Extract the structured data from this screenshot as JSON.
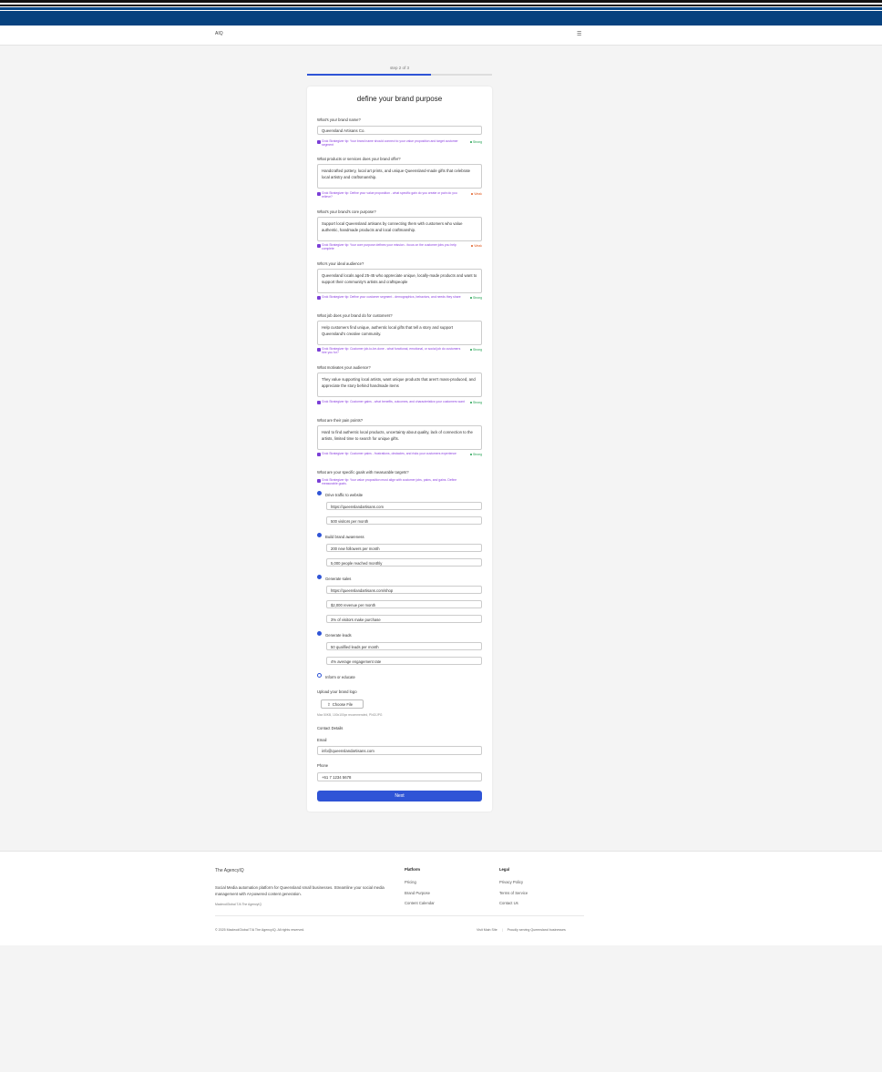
{
  "header": {
    "logo_alt": "AIQ",
    "menu_icon": "hamburger-icon"
  },
  "progress": {
    "label": "step 2 of 3",
    "value": 0.67
  },
  "form": {
    "title": "define your brand purpose",
    "tip_prefix": "Grok Strategizer tip:",
    "questions": [
      {
        "label": "What's your brand name?",
        "value": "Queensland Artisans Co.",
        "tip": "Grok Strategizer tip: Your brand name should connect to your value proposition and target customer segment",
        "strength": "Strong"
      },
      {
        "label": "What products or services does your brand offer?",
        "value": "Handcrafted pottery, local art prints, and unique Queensland-made gifts that celebrate local artistry and craftsmanship.",
        "tip": "Grok Strategizer tip: Define your value proposition - what specific gain do you create or pain do you relieve?",
        "strength": "Weak"
      },
      {
        "label": "What's your brand's core purpose?",
        "value": "Support local Queensland artisans by connecting them with customers who value authentic, handmade products and local craftmanship.",
        "tip": "Grok Strategizer tip: Your core purpose defines your mission - focus on the customer jobs you help complete",
        "strength": "Weak"
      },
      {
        "label": "Who's your ideal audience?",
        "value": "Queensland locals aged 25-45 who appreciate unique, locally-made products and want to support their community's artists and craftspeople",
        "tip": "Grok Strategizer tip: Define your customer segment - demographics, behaviors, and needs they share",
        "strength": "Strong"
      },
      {
        "label": "What job does your brand do for customers?",
        "value": "Help customers find unique, authentic local gifts that tell a story and support Queensland's creative community.",
        "tip": "Grok Strategizer tip: Customer job-to-be-done - what functional, emotional, or social job do customers hire you for?",
        "strength": "Strong"
      },
      {
        "label": "What motivates your audience?",
        "value": "They value supporting local artists, want unique products that aren't mass-produced, and appreciate the story behind handmade items",
        "tip": "Grok Strategizer tip: Customer gains - what benefits, outcomes, and characteristics your customers want",
        "strength": "Strong"
      },
      {
        "label": "What are their pain points?",
        "value": "Hard to find authentic local products, uncertainty about quality, lack of connection to the artists, limited time to search for unique gifts.",
        "tip": "Grok Strategizer tip: Customer pains - frustrations, obstacles, and risks your customers experience",
        "strength": "Strong"
      }
    ],
    "goals": {
      "label": "What are your specific goals with measurable targets?",
      "tip": "Grok Strategizer tip: Your value proposition must align with customer jobs, pains, and gains. Define measurable goals.",
      "items": [
        {
          "label": "Drive traffic to website",
          "checked": true,
          "fields": [
            "https://queenslandartisans.com",
            "500 visitors per month"
          ]
        },
        {
          "label": "Build brand awareness",
          "checked": true,
          "fields": [
            "200 new followers per month",
            "5,000 people reached monthly"
          ]
        },
        {
          "label": "Generate sales",
          "checked": true,
          "fields": [
            "https://queenslandartisans.com/shop",
            "$2,000 revenue per month",
            "3% of visitors make purchase"
          ]
        },
        {
          "label": "Generate leads",
          "checked": true,
          "fields": [
            "50 qualified leads per month",
            "4% average engagement rate"
          ]
        },
        {
          "label": "Inform or educate",
          "checked": false,
          "fields": []
        }
      ]
    },
    "logo_upload": {
      "label": "Upload your brand logo",
      "button": "Choose File",
      "note": "Max 50KB, 100x100px recommended, PNG/JPG"
    },
    "contact": {
      "heading": "Contact Details",
      "email_label": "Email",
      "email_value": "info@queenslandartisans.com",
      "phone_label": "Phone",
      "phone_value": "+61 7 1234 5678"
    },
    "next_button": "Next"
  },
  "footer": {
    "logo_alt": "The AgencyIQ",
    "description": "Social Media automation platform for Queensland small businesses. Streamline your social media management with AI-powered content generation.",
    "company": "MacleodGlobal T/A The AgencyIQ",
    "platform_title": "Platform",
    "platform_links": [
      "Pricing",
      "Brand Purpose",
      "Content Calendar"
    ],
    "legal_title": "Legal",
    "legal_links": [
      "Privacy Policy",
      "Terms of Service",
      "Contact Us"
    ],
    "copyright": "© 2025 MacleodGlobal T/A The AgencyIQ. All rights reserved.",
    "visit_site": "Visit Main Site",
    "tagline": "Proudly serving Queensland businesses"
  },
  "colors": {
    "accent": "#2f54d6",
    "header": "#07427f",
    "tip": "#8b3fe0",
    "strong": "#20a050",
    "weak": "#e05a20"
  }
}
